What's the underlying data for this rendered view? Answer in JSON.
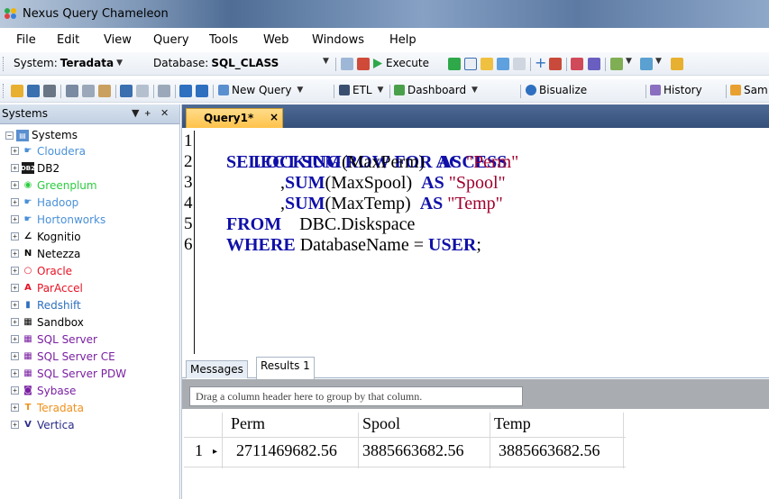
{
  "window": {
    "title": "Nexus Query Chameleon"
  },
  "menu": [
    "File",
    "Edit",
    "View",
    "Query",
    "Tools",
    "Web",
    "Windows",
    "Help"
  ],
  "toolbar1": {
    "system_label": "System:",
    "system_value": "Teradata",
    "database_label": "Database:",
    "database_value": "SQL_CLASS",
    "execute_label": "Execute"
  },
  "toolbar2": {
    "new_query": "New Query",
    "etl": "ETL",
    "dashboard": "Dashboard",
    "bisualize": "Bisualize",
    "history": "History",
    "sam": "Sam"
  },
  "systems_panel": {
    "title": "Systems",
    "pin": "↓ q ×",
    "root": "Systems",
    "items": [
      {
        "label": "Cloudera",
        "color": "#4a90d9",
        "icon": "folder-hand-icon"
      },
      {
        "label": "DB2",
        "color": "#000000",
        "icon": "db2-icon"
      },
      {
        "label": "Greenplum",
        "color": "#2ecc40",
        "icon": "greenplum-icon"
      },
      {
        "label": "Hadoop",
        "color": "#4a90d9",
        "icon": "hadoop-icon"
      },
      {
        "label": "Hortonworks",
        "color": "#4a90d9",
        "icon": "hortonworks-icon"
      },
      {
        "label": "Kognitio",
        "color": "#000000",
        "icon": "kognitio-icon"
      },
      {
        "label": "Netezza",
        "color": "#000000",
        "icon": "netezza-icon"
      },
      {
        "label": "Oracle",
        "color": "#e81123",
        "icon": "oracle-icon"
      },
      {
        "label": "ParAccel",
        "color": "#e81123",
        "icon": "paraccel-icon"
      },
      {
        "label": "Redshift",
        "color": "#2f6fbf",
        "icon": "redshift-icon"
      },
      {
        "label": "Sandbox",
        "color": "#000000",
        "icon": "sql-icon"
      },
      {
        "label": "SQL Server",
        "color": "#7a1fa2",
        "icon": "sql-icon"
      },
      {
        "label": "SQL Server CE",
        "color": "#7a1fa2",
        "icon": "sql-icon"
      },
      {
        "label": "SQL Server PDW",
        "color": "#7a1fa2",
        "icon": "sql-icon"
      },
      {
        "label": "Sybase",
        "color": "#7a1fa2",
        "icon": "sybase-icon"
      },
      {
        "label": "Teradata",
        "color": "#f0901c",
        "icon": "teradata-icon"
      },
      {
        "label": "Vertica",
        "color": "#2a2a8a",
        "icon": "vertica-icon"
      }
    ]
  },
  "editor": {
    "tab_label": "Query1*",
    "tab_close": "×",
    "line_numbers": [
      "1",
      "2",
      "3",
      "4",
      "5",
      "6"
    ],
    "lines": [
      {
        "kw1": "LOCKING ROW FOR ACCESS"
      },
      {
        "kw1": "SELECT SUM",
        "t1": "(MaxPerm)   ",
        "kw2": "AS",
        "s": " \"Perm\""
      },
      {
        "p": "            ,",
        "kw1": "SUM",
        "t1": "(MaxSpool)  ",
        "kw2": "AS",
        "s": " \"Spool\""
      },
      {
        "p": "            ,",
        "kw1": "SUM",
        "t1": "(MaxTemp)  ",
        "kw2": "AS",
        "s": " \"Temp\""
      },
      {
        "kw1": "FROM",
        "t1": "    DBC.Diskspace"
      },
      {
        "kw1": "WHERE",
        "t1": " DatabaseName = ",
        "kw2": "USER",
        "t2": ";"
      }
    ]
  },
  "results": {
    "tabs": [
      "Messages",
      "Results 1"
    ],
    "group_hint": "Drag a column header here to group by that column.",
    "columns": [
      "Perm",
      "Spool",
      "Temp"
    ],
    "rows": [
      {
        "num": "1",
        "cells": [
          "2711469682.56",
          "3885663682.56",
          "3885663682.56"
        ]
      }
    ]
  }
}
